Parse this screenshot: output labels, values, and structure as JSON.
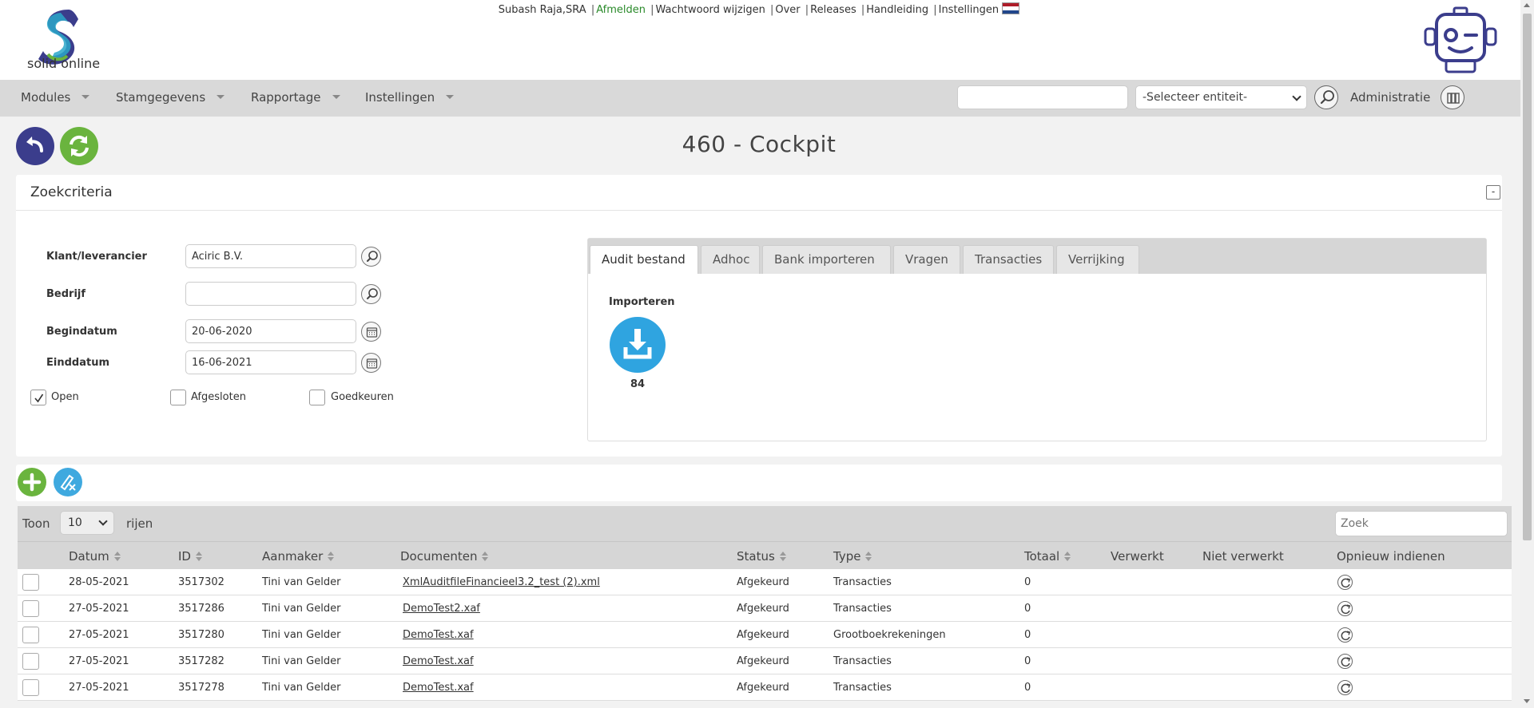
{
  "header": {
    "logo_text": "solid online",
    "user": "Subash Raja,SRA",
    "links": {
      "logout": "Afmelden",
      "change_password": "Wachtwoord wijzigen",
      "about": "Over",
      "releases": "Releases",
      "manual": "Handleiding",
      "settings": "Instellingen"
    },
    "flag_icon": "netherlands-flag-icon",
    "robot_icon": "robot-mascot-icon"
  },
  "menu": {
    "items": [
      "Modules",
      "Stamgegevens",
      "Rapportage",
      "Instellingen"
    ],
    "search_value": "",
    "entity_select": "-Selecteer entiteit-",
    "administratie": "Administratie"
  },
  "toolbar": {
    "back_icon": "undo-icon",
    "refresh_icon": "refresh-icon"
  },
  "page": {
    "title": "460 - Cockpit"
  },
  "search_panel": {
    "title": "Zoekcriteria",
    "collapse_symbol": "-",
    "fields": {
      "klant_label": "Klant/leverancier",
      "klant_value": "Aciric B.V.",
      "bedrijf_label": "Bedrijf",
      "bedrijf_value": "",
      "begindatum_label": "Begindatum",
      "begindatum_value": "20-06-2020",
      "einddatum_label": "Einddatum",
      "einddatum_value": "16-06-2021"
    },
    "checkboxes": {
      "open_label": "Open",
      "open_checked": true,
      "afgesloten_label": "Afgesloten",
      "afgesloten_checked": false,
      "goedkeuren_label": "Goedkeuren",
      "goedkeuren_checked": false
    }
  },
  "tabs": {
    "items": [
      "Audit bestand",
      "Adhoc",
      "Bank importeren",
      "Vragen",
      "Transacties",
      "Verrijking"
    ],
    "active": "Audit bestand",
    "import_label": "Importeren",
    "import_count": "84"
  },
  "table": {
    "toon_label": "Toon",
    "page_size": "10",
    "rijen_label": "rijen",
    "search_placeholder": "Zoek",
    "columns": {
      "datum": "Datum",
      "id": "ID",
      "aanmaker": "Aanmaker",
      "documenten": "Documenten",
      "status": "Status",
      "type": "Type",
      "totaal": "Totaal",
      "verwerkt": "Verwerkt",
      "niet_verwerkt": "Niet verwerkt",
      "opnieuw": "Opnieuw indienen"
    },
    "rows": [
      {
        "datum": "28-05-2021",
        "id": "3517302",
        "aanmaker": "Tini van Gelder",
        "document": "XmlAuditfileFinancieel3.2_test (2).xml",
        "status": "Afgekeurd",
        "type": "Transacties",
        "totaal": "0"
      },
      {
        "datum": "27-05-2021",
        "id": "3517286",
        "aanmaker": "Tini van Gelder",
        "document": "DemoTest2.xaf",
        "status": "Afgekeurd",
        "type": "Transacties",
        "totaal": "0"
      },
      {
        "datum": "27-05-2021",
        "id": "3517280",
        "aanmaker": "Tini van Gelder",
        "document": "DemoTest.xaf",
        "status": "Afgekeurd",
        "type": "Grootboekrekeningen",
        "totaal": "0"
      },
      {
        "datum": "27-05-2021",
        "id": "3517282",
        "aanmaker": "Tini van Gelder",
        "document": "DemoTest.xaf",
        "status": "Afgekeurd",
        "type": "Transacties",
        "totaal": "0"
      },
      {
        "datum": "27-05-2021",
        "id": "3517278",
        "aanmaker": "Tini van Gelder",
        "document": "DemoTest.xaf",
        "status": "Afgekeurd",
        "type": "Transacties",
        "totaal": "0"
      }
    ]
  },
  "colors": {
    "accent_green": "#6ab43e",
    "accent_navy": "#3b3d8c",
    "accent_blue": "#2fa4e0",
    "logout_green": "#2a8a2a"
  }
}
